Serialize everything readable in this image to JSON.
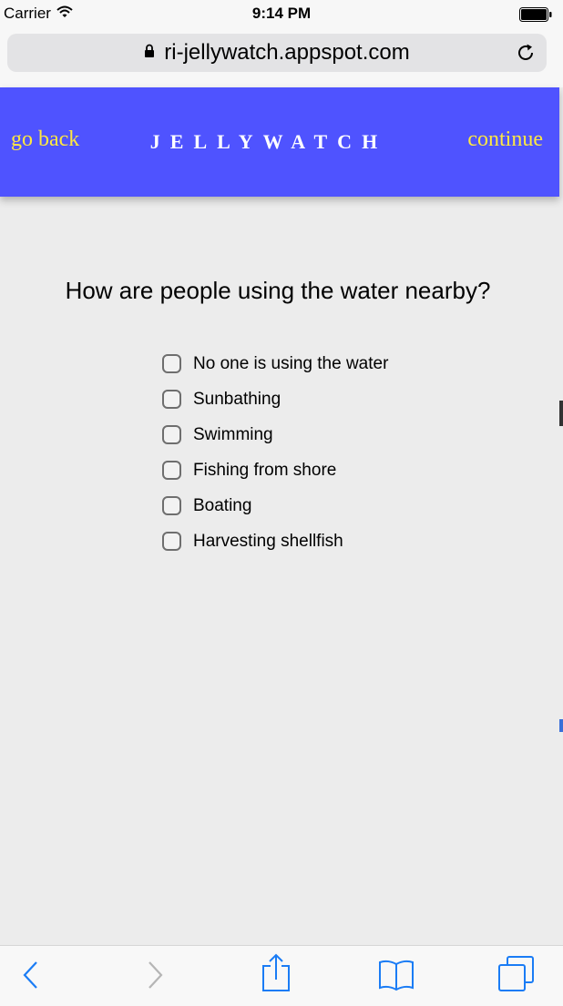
{
  "status_bar": {
    "carrier": "Carrier",
    "time": "9:14 PM"
  },
  "browser": {
    "url": "ri-jellywatch.appspot.com"
  },
  "header": {
    "back_label": "go back",
    "title": "JELLYWATCH",
    "continue_label": "continue"
  },
  "question": "How are people using the water nearby?",
  "options": [
    {
      "label": "No one is using the water",
      "checked": false
    },
    {
      "label": "Sunbathing",
      "checked": false
    },
    {
      "label": "Swimming",
      "checked": false
    },
    {
      "label": "Fishing from shore",
      "checked": false
    },
    {
      "label": "Boating",
      "checked": false
    },
    {
      "label": "Harvesting shellfish",
      "checked": false
    }
  ],
  "toolbar": {
    "icons": [
      "back-arrow-icon",
      "forward-arrow-icon",
      "share-icon",
      "bookmarks-icon",
      "tabs-icon"
    ]
  },
  "colors": {
    "header_bg": "#4f53ff",
    "header_link": "#ffe840",
    "toolbar_icon": "#1a7cf5",
    "page_bg": "#ececec"
  }
}
